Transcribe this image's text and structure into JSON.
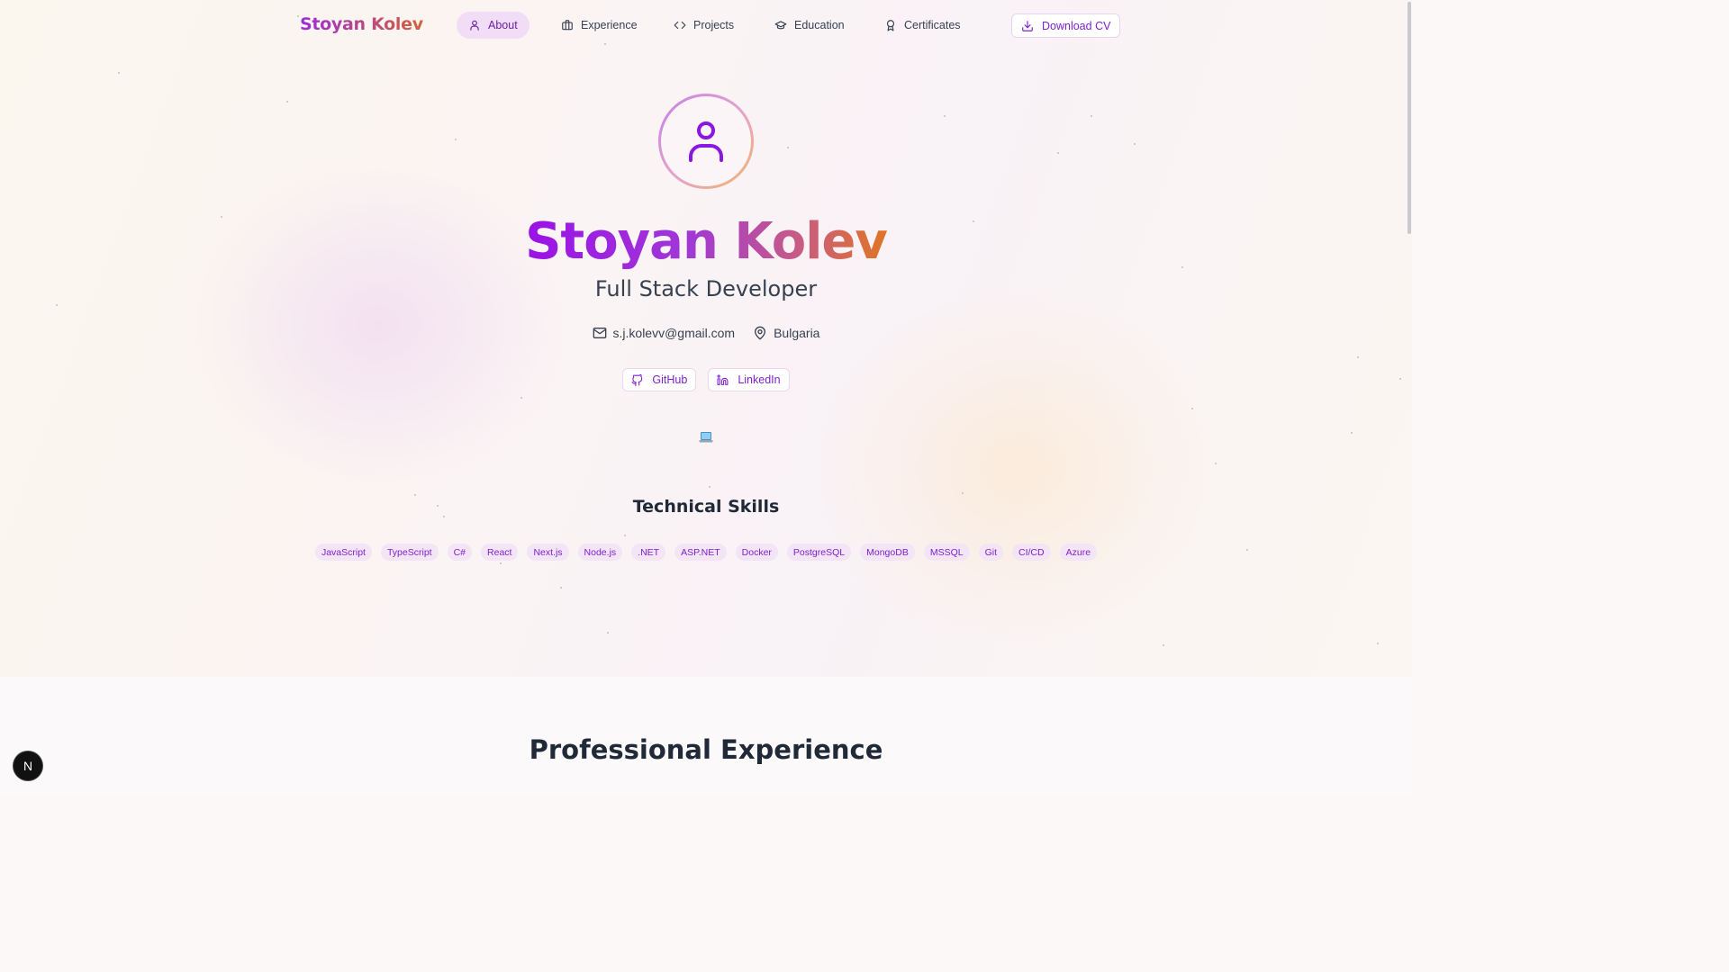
{
  "brand": "Stoyan Kolev",
  "nav": {
    "items": [
      {
        "label": "About",
        "icon": "user-icon",
        "active": true
      },
      {
        "label": "Experience",
        "icon": "briefcase-icon"
      },
      {
        "label": "Projects",
        "icon": "code-icon"
      },
      {
        "label": "Education",
        "icon": "graduation-cap-icon"
      },
      {
        "label": "Certificates",
        "icon": "award-icon"
      }
    ],
    "download_label": "Download CV"
  },
  "hero": {
    "name": "Stoyan Kolev",
    "role": "Full Stack Developer",
    "email": "s.j.kolevv@gmail.com",
    "location": "Bulgaria",
    "github_label": "GitHub",
    "linkedin_label": "LinkedIn"
  },
  "skills": {
    "title": "Technical Skills",
    "items": [
      "JavaScript",
      "TypeScript",
      "C#",
      "React",
      "Next.js",
      "Node.js",
      ".NET",
      "ASP.NET",
      "Docker",
      "PostgreSQL",
      "MongoDB",
      "MSSQL",
      "Git",
      "CI/CD",
      "Azure"
    ]
  },
  "experience": {
    "title": "Professional Experience"
  },
  "dev_badge": "N",
  "colors": {
    "accent": "#7e22ce",
    "gradient_start": "#9a12e6",
    "gradient_end": "#e07524"
  }
}
